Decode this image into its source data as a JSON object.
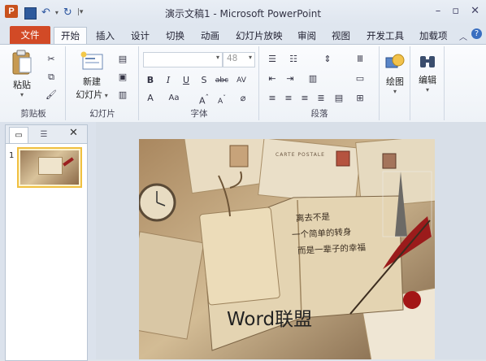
{
  "window": {
    "title": "演示文稿1 - Microsoft PowerPoint"
  },
  "tabs": [
    "文件",
    "开始",
    "插入",
    "设计",
    "切换",
    "动画",
    "幻灯片放映",
    "审阅",
    "视图",
    "开发工具",
    "加载项"
  ],
  "ribbon": {
    "clipboard": {
      "label": "剪贴板",
      "paste": "粘贴"
    },
    "slides": {
      "label": "幻灯片",
      "new_line1": "新建",
      "new_line2": "幻灯片"
    },
    "font": {
      "label": "字体",
      "size": "48"
    },
    "paragraph": {
      "label": "段落"
    },
    "drawing": {
      "label": "绘图"
    },
    "editing": {
      "label": "编辑"
    }
  },
  "thumbnails": [
    {
      "number": "1"
    }
  ],
  "slide": {
    "caption": "Word联盟",
    "poem": [
      "离去不是",
      "一个简单的转身",
      "而是一辈子的幸福"
    ],
    "postmark": "CARTE POSTALE"
  },
  "colors": {
    "file_tab": "#d24a26",
    "selected_thumb": "#f7d26a"
  }
}
